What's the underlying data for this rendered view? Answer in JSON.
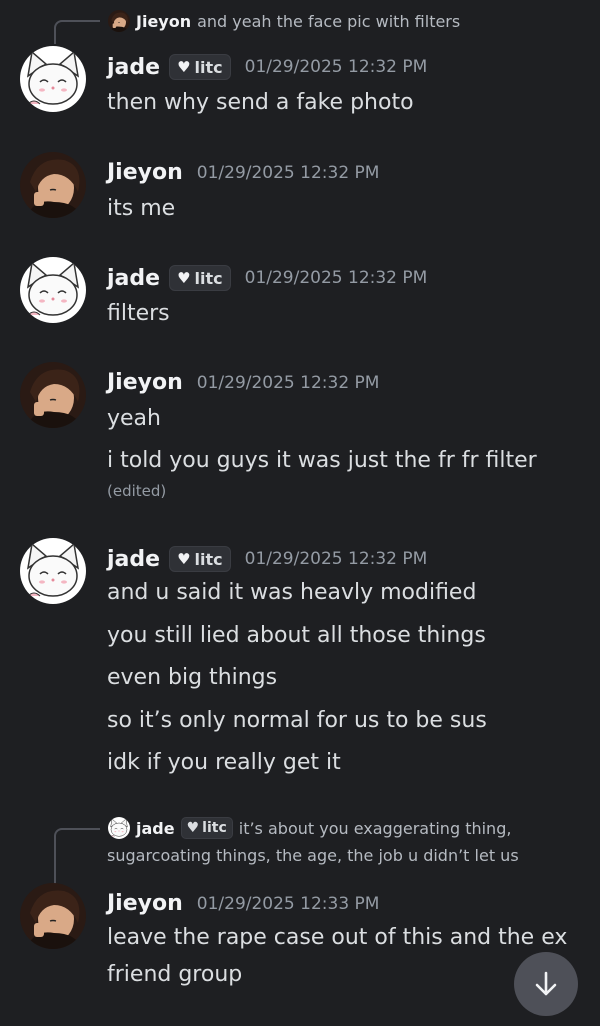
{
  "top_reply": {
    "author": "Jieyon",
    "text": "and yeah the face pic with filters"
  },
  "messages": [
    {
      "author": "jade",
      "tag": "litc",
      "time": "01/29/2025 12:32 PM",
      "lines": [
        "then why send a fake photo"
      ]
    },
    {
      "author": "Jieyon",
      "time": "01/29/2025 12:32 PM",
      "lines": [
        "its me"
      ]
    },
    {
      "author": "jade",
      "tag": "litc",
      "time": "01/29/2025 12:32 PM",
      "lines": [
        "filters"
      ]
    },
    {
      "author": "Jieyon",
      "time": "01/29/2025 12:32 PM",
      "lines": [
        "yeah",
        "i told you guys it was just the fr fr filter"
      ],
      "edited": "(edited)"
    },
    {
      "author": "jade",
      "tag": "litc",
      "time": "01/29/2025 12:32 PM",
      "lines": [
        "and u said it was heavly modified",
        "you still lied about all those things",
        "even big things",
        "so it’s only normal for us to be sus",
        "idk if you really get it"
      ]
    },
    {
      "author": "Jieyon",
      "time": "01/29/2025 12:33 PM",
      "lines": [
        "leave the rape case out of this and the ex",
        "friend group"
      ]
    }
  ],
  "bottom_reply": {
    "author": "jade",
    "tag": "litc",
    "text1": "it’s about you exaggerating thing,",
    "text2": "sugarcoating things, the age, the job u didn’t let us"
  },
  "icons": {
    "heart": "♥",
    "scroll": "arrow-down-icon"
  }
}
